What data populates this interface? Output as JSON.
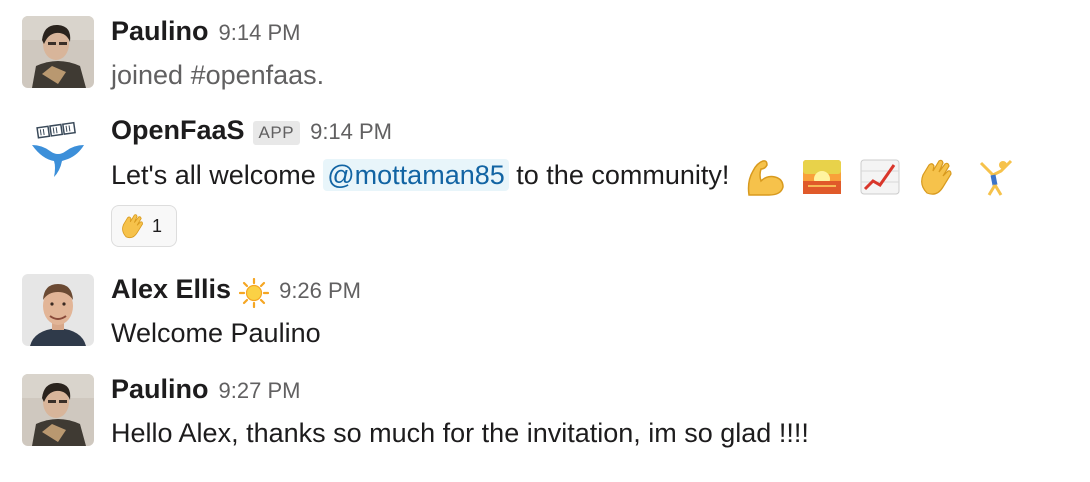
{
  "messages": [
    {
      "author": "Paulino",
      "time": "9:14 PM",
      "text": "joined #openfaas.",
      "avatar": "paulino-avatar"
    },
    {
      "author": "OpenFaaS",
      "badge": "APP",
      "time": "9:14 PM",
      "text_before": "Let's all welcome",
      "mention": "@mottaman85",
      "text_after": "to the community!",
      "emojis": [
        "flexed-biceps",
        "sunrise",
        "chart-increasing",
        "waving-hand",
        "person-cartwheeling"
      ],
      "reaction": {
        "emoji": "waving-hand",
        "count": "1"
      },
      "avatar": "openfaas-whale-logo"
    },
    {
      "author": "Alex Ellis",
      "status_emoji": "sun",
      "time": "9:26 PM",
      "text": "Welcome Paulino",
      "avatar": "alex-avatar"
    },
    {
      "author": "Paulino",
      "time": "9:27 PM",
      "text": "Hello Alex, thanks so much for the invitation, im so glad !!!!",
      "avatar": "paulino-avatar"
    }
  ],
  "colors": {
    "text": "#1d1c1d",
    "muted": "#616061",
    "mention_bg": "#e8f5fa",
    "mention_fg": "#1264a3",
    "badge_bg": "#e8e8e8"
  }
}
